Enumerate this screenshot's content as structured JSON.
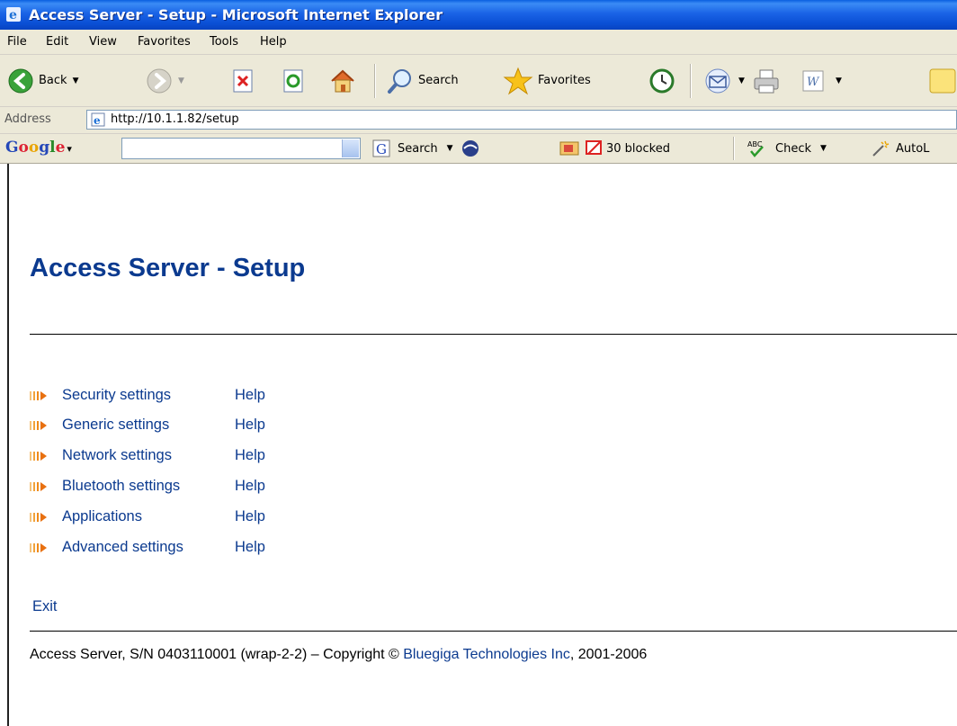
{
  "window": {
    "title": "Access Server - Setup - Microsoft Internet Explorer"
  },
  "menu": [
    "File",
    "Edit",
    "View",
    "Favorites",
    "Tools",
    "Help"
  ],
  "toolbar": {
    "back_label": "Back",
    "search_label": "Search",
    "favorites_label": "Favorites"
  },
  "address": {
    "label": "Address",
    "url": "http://10.1.1.82/setup"
  },
  "googlebar": {
    "logo": "Google",
    "search_label": "Search",
    "blocked_label": "30 blocked",
    "check_label": "Check",
    "autolink_label": "AutoL"
  },
  "page": {
    "heading": "Access Server - Setup",
    "links": [
      {
        "label": "Security settings",
        "help": "Help"
      },
      {
        "label": "Generic settings",
        "help": "Help"
      },
      {
        "label": "Network settings",
        "help": "Help"
      },
      {
        "label": "Bluetooth settings",
        "help": "Help"
      },
      {
        "label": "Applications",
        "help": "Help"
      },
      {
        "label": "Advanced settings",
        "help": "Help"
      }
    ],
    "exit_label": "Exit",
    "footer": {
      "prefix": "Access Server, S/N 0403110001 (wrap-2-2)  –  Copyright © ",
      "company": "Bluegiga Technologies Inc",
      "suffix": ", 2001-2006"
    }
  },
  "colors": {
    "link": "#0b3a8f",
    "titlebar": "#0a4fd4",
    "chrome": "#ece9d8"
  }
}
